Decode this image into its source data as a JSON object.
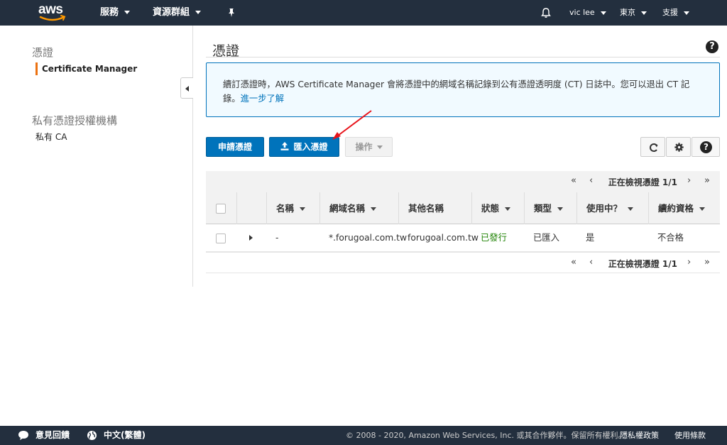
{
  "topbar": {
    "logo": "aws",
    "services": "服務",
    "resource_groups": "資源群組",
    "user": "vic lee",
    "region": "東京",
    "support": "支援"
  },
  "sidebar": {
    "section1_title": "憑證",
    "section1_active": "Certificate Manager",
    "section2_title": "私有憑證授權機構",
    "section2_item": "私有 CA"
  },
  "main": {
    "title": "憑證",
    "info_text": "續訂憑證時，AWS Certificate Manager 會將憑證中的網域名稱記錄到公有憑證透明度 (CT) 日誌中。您可以退出 CT 記錄。",
    "info_link": "進一步了解",
    "buttons": {
      "request": "申請憑證",
      "import": "匯入憑證",
      "actions": "操作"
    },
    "pager_text": "正在檢視憑證 1/1",
    "columns": [
      "名稱",
      "網域名稱",
      "其他名稱",
      "狀態",
      "類型",
      "使用中？",
      "續約資格"
    ],
    "rows": [
      {
        "name": "-",
        "domain": "*.forugoal.com.tw",
        "alt_name": "forugoal.com.tw",
        "status": "已發行",
        "type": "已匯入",
        "in_use": "是",
        "renewal": "不合格"
      }
    ]
  },
  "footer": {
    "feedback": "意見回饋",
    "language": "中文(繁體)",
    "copyright": "© 2008 - 2020, Amazon Web Services, Inc. 或其合作夥伴。保留所有權利。",
    "privacy": "隱私權政策",
    "terms": "使用條款"
  },
  "colors": {
    "topbar": "#232f3e",
    "primary": "#0073bb",
    "accent": "#ec7211",
    "status_ok": "#1d8102"
  },
  "icons": [
    "aws-logo-icon",
    "pin-icon",
    "bell-icon",
    "help-icon",
    "refresh-icon",
    "gear-icon",
    "upload-icon",
    "feedback-icon",
    "globe-icon"
  ]
}
